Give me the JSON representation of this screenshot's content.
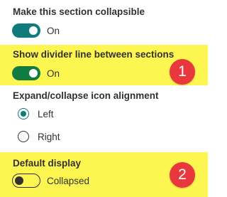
{
  "colors": {
    "toggle_on_teal": "#0f7b7b",
    "toggle_on_green": "#107c41",
    "highlight": "#fdf650",
    "badge": "#e8383d"
  },
  "sections": [
    {
      "label": "Make this section collapsible",
      "toggle_state": "On",
      "toggle_on": true
    },
    {
      "label": "Show divider line between sections",
      "toggle_state": "On",
      "toggle_on": true
    },
    {
      "label": "Expand/collapse icon alignment",
      "options": [
        "Left",
        "Right"
      ],
      "selected": "Left"
    },
    {
      "label": "Default display",
      "toggle_state": "Collapsed",
      "toggle_on": false
    }
  ],
  "badges": [
    "1",
    "2"
  ]
}
